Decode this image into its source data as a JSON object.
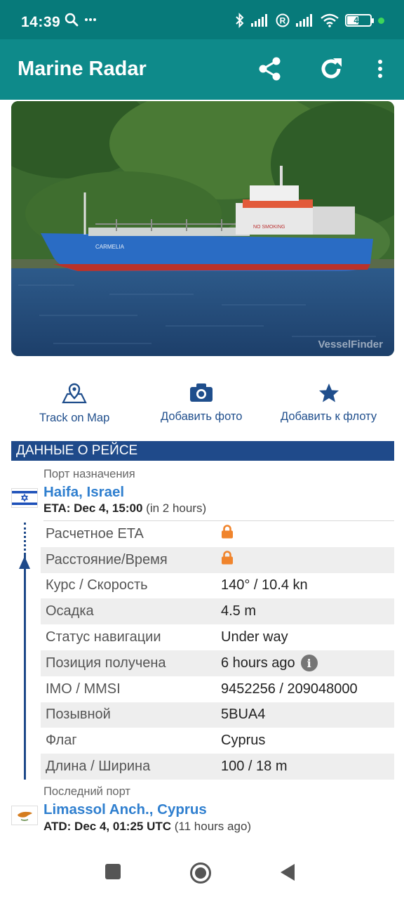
{
  "status_bar": {
    "time": "14:39",
    "battery": "49",
    "icons": [
      "search-icon",
      "more-dots-icon",
      "bluetooth-icon",
      "signal-icon",
      "roaming-r-icon",
      "signal-icon",
      "wifi-icon",
      "battery-icon",
      "green-dot"
    ]
  },
  "app_bar": {
    "title": "Marine Radar",
    "actions": [
      "share-icon",
      "refresh-icon",
      "overflow-menu-icon"
    ]
  },
  "photo": {
    "ship_name": "CARMELIA",
    "deck_sign": "NO SMOKING",
    "watermark": "VesselFinder"
  },
  "actions": {
    "track": "Track on Map",
    "add_photo": "Добавить фото",
    "add_fleet": "Добавить к флоту"
  },
  "voyage": {
    "header": "ДАННЫЕ О РЕЙСЕ",
    "destination": {
      "label": "Порт назначения",
      "name": "Haifa, Israel",
      "eta_label": "ETA: Dec 4, 15:00",
      "eta_rel": "(in 2 hours)"
    },
    "rows": [
      {
        "key": "Расчетное ETA",
        "value": "",
        "locked": true
      },
      {
        "key": "Расстояние/Время",
        "value": "",
        "locked": true
      },
      {
        "key": "Курс / Скорость",
        "value": "140° / 10.4 kn"
      },
      {
        "key": "Осадка",
        "value": "4.5 m"
      },
      {
        "key": "Статус навигации",
        "value": "Under way"
      },
      {
        "key": "Позиция получена",
        "value": "6 hours ago",
        "info": true
      },
      {
        "key": "IMO / MMSI",
        "value": "9452256 / 209048000"
      },
      {
        "key": "Позывной",
        "value": "5BUA4"
      },
      {
        "key": "Флаг",
        "value": "Cyprus"
      },
      {
        "key": "Длина / Ширина",
        "value": "100 / 18 m"
      }
    ],
    "last_port": {
      "label": "Последний порт",
      "name": "Limassol Anch., Cyprus",
      "atd_label": "ATD: Dec 4, 01:25 UTC",
      "atd_rel": "(11 hours ago)"
    }
  },
  "colors": {
    "status_bar": "#077a7a",
    "app_bar": "#0e8a8a",
    "section_header": "#1f4a8a",
    "link": "#2f7fcf",
    "lock": "#f0842c"
  }
}
